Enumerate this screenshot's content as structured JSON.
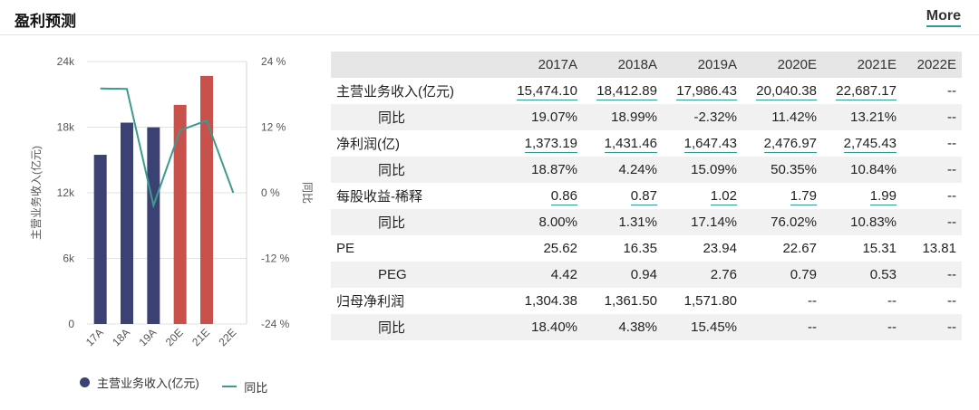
{
  "header": {
    "title": "盈利预测",
    "more_label": "More"
  },
  "chart_data": {
    "type": "bar",
    "categories": [
      "17A",
      "18A",
      "19A",
      "20E",
      "21E",
      "22E"
    ],
    "ylabel": "主营业务收入(亿元)",
    "y2label": "同比",
    "ylim": [
      0,
      24000
    ],
    "y2lim": [
      -24,
      24
    ],
    "y_ticks": [
      "0",
      "6k",
      "12k",
      "18k",
      "24k"
    ],
    "y2_ticks": [
      "-24 %",
      "-12 %",
      "0 %",
      "12 %",
      "24 %"
    ],
    "series": [
      {
        "name": "主营业务收入(亿元)",
        "kind": "bar",
        "values": [
          15474.1,
          18412.89,
          17986.43,
          20040.38,
          22687.17,
          null
        ],
        "colors": [
          "#3b4173",
          "#3b4173",
          "#3b4173",
          "#c9514b",
          "#c9514b",
          "#c9514b"
        ]
      },
      {
        "name": "同比",
        "kind": "line",
        "axis": "right",
        "color": "#3e9a8f",
        "values": [
          19.07,
          18.99,
          -2.32,
          11.42,
          13.21,
          0
        ]
      }
    ],
    "legend": "bottom-left",
    "grid": true
  },
  "legend": {
    "bar": "主营业务收入(亿元)",
    "line": "同比"
  },
  "table": {
    "columns": [
      "",
      "2017A",
      "2018A",
      "2019A",
      "2020E",
      "2021E",
      "2022E"
    ],
    "rows": [
      {
        "label": "主营业务收入(亿元)",
        "sub": false,
        "link": true,
        "values": [
          "15,474.10",
          "18,412.89",
          "17,986.43",
          "20,040.38",
          "22,687.17",
          "--"
        ]
      },
      {
        "label": "同比",
        "sub": true,
        "link": false,
        "values": [
          "19.07%",
          "18.99%",
          "-2.32%",
          "11.42%",
          "13.21%",
          "--"
        ]
      },
      {
        "label": "净利润(亿)",
        "sub": false,
        "link": true,
        "values": [
          "1,373.19",
          "1,431.46",
          "1,647.43",
          "2,476.97",
          "2,745.43",
          "--"
        ]
      },
      {
        "label": "同比",
        "sub": true,
        "link": false,
        "values": [
          "18.87%",
          "4.24%",
          "15.09%",
          "50.35%",
          "10.84%",
          "--"
        ]
      },
      {
        "label": "每股收益-稀释",
        "sub": false,
        "link": true,
        "values": [
          "0.86",
          "0.87",
          "1.02",
          "1.79",
          "1.99",
          "--"
        ]
      },
      {
        "label": "同比",
        "sub": true,
        "link": false,
        "values": [
          "8.00%",
          "1.31%",
          "17.14%",
          "76.02%",
          "10.83%",
          "--"
        ]
      },
      {
        "label": "PE",
        "sub": false,
        "link": false,
        "values": [
          "25.62",
          "16.35",
          "23.94",
          "22.67",
          "15.31",
          "13.81"
        ]
      },
      {
        "label": "PEG",
        "sub": true,
        "link": false,
        "values": [
          "4.42",
          "0.94",
          "2.76",
          "0.79",
          "0.53",
          "--"
        ]
      },
      {
        "label": "归母净利润",
        "sub": false,
        "link": false,
        "values": [
          "1,304.38",
          "1,361.50",
          "1,571.80",
          "--",
          "--",
          "--"
        ]
      },
      {
        "label": "同比",
        "sub": true,
        "link": false,
        "values": [
          "18.40%",
          "4.38%",
          "15.45%",
          "--",
          "--",
          "--"
        ]
      }
    ]
  }
}
